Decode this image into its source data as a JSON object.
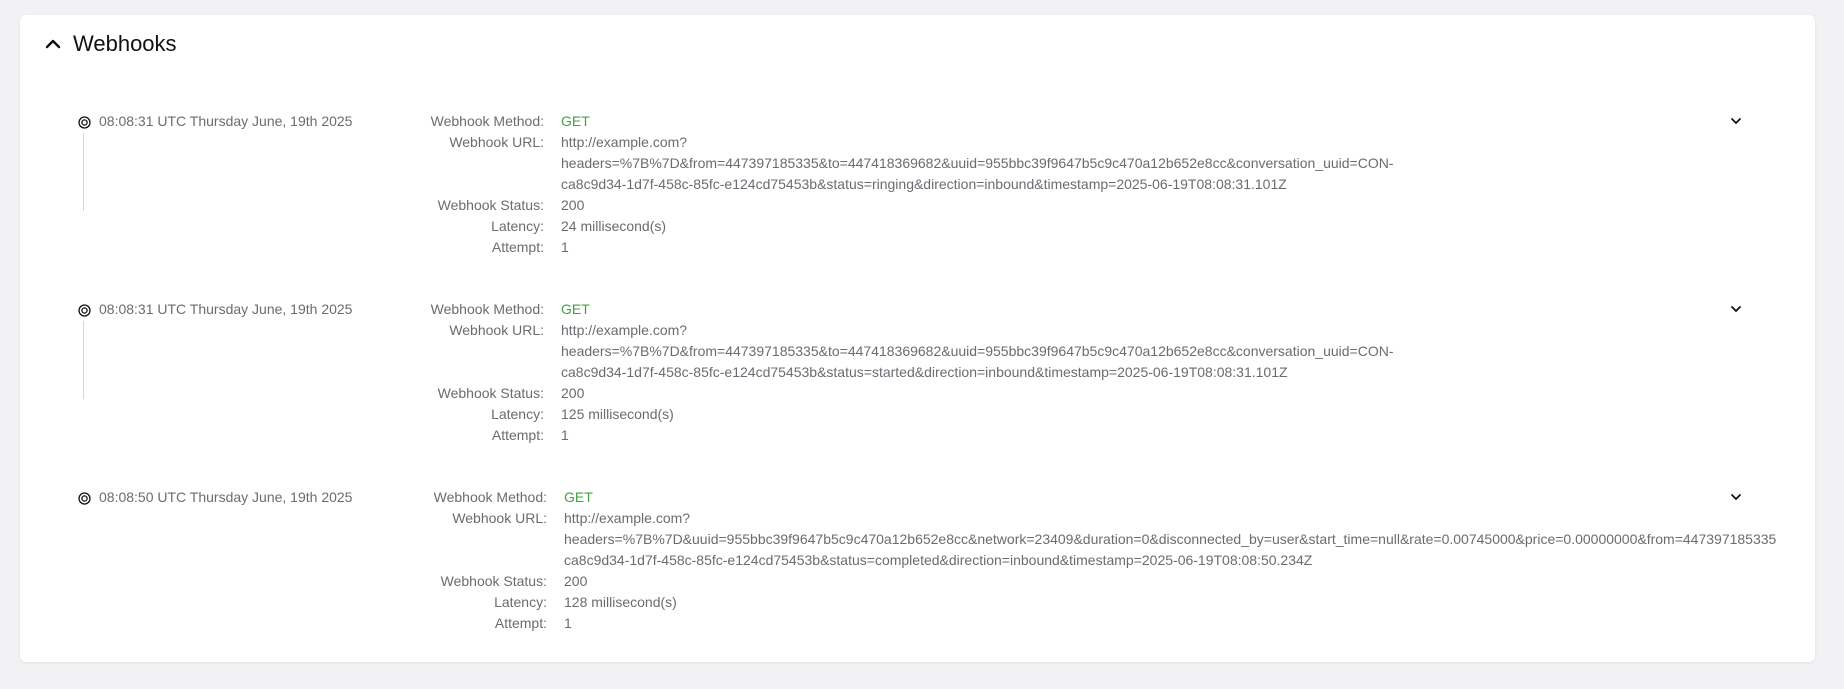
{
  "section": {
    "title": "Webhooks"
  },
  "labels": {
    "method": "Webhook Method:",
    "url": "Webhook URL:",
    "status": "Webhook Status:",
    "latency": "Latency:",
    "attempt": "Attempt:"
  },
  "colors": {
    "method_green": "#3fa544",
    "text_gray": "#6b6b72",
    "title_black": "#111113"
  },
  "icons": {
    "collapse": "chevron-up-icon",
    "expand": "chevron-down-icon",
    "timeline": "target-circle-icon"
  },
  "events": [
    {
      "time": "08:08:31 UTC Thursday June, 19th 2025",
      "method": "GET",
      "url_lines": [
        "http://example.com?",
        "headers=%7B%7D&from=447397185335&to=447418369682&uuid=955bbc39f9647b5c9c470a12b652e8cc&conversation_uuid=CON-",
        "ca8c9d34-1d7f-458c-85fc-e124cd75453b&status=ringing&direction=inbound&timestamp=2025-06-19T08:08:31.101Z"
      ],
      "status": "200",
      "latency": "24 millisecond(s)",
      "attempt": "1"
    },
    {
      "time": "08:08:31 UTC Thursday June, 19th 2025",
      "method": "GET",
      "url_lines": [
        "http://example.com?",
        "headers=%7B%7D&from=447397185335&to=447418369682&uuid=955bbc39f9647b5c9c470a12b652e8cc&conversation_uuid=CON-",
        "ca8c9d34-1d7f-458c-85fc-e124cd75453b&status=started&direction=inbound&timestamp=2025-06-19T08:08:31.101Z"
      ],
      "status": "200",
      "latency": "125 millisecond(s)",
      "attempt": "1"
    },
    {
      "time": "08:08:50 UTC Thursday June, 19th 2025",
      "method": "GET",
      "url_lines": [
        "http://example.com?",
        "headers=%7B%7D&uuid=955bbc39f9647b5c9c470a12b652e8cc&network=23409&duration=0&disconnected_by=user&start_time=null&rate=0.00745000&price=0.00000000&from=447397185335",
        "ca8c9d34-1d7f-458c-85fc-e124cd75453b&status=completed&direction=inbound&timestamp=2025-06-19T08:08:50.234Z"
      ],
      "status": "200",
      "latency": "128 millisecond(s)",
      "attempt": "1"
    }
  ]
}
